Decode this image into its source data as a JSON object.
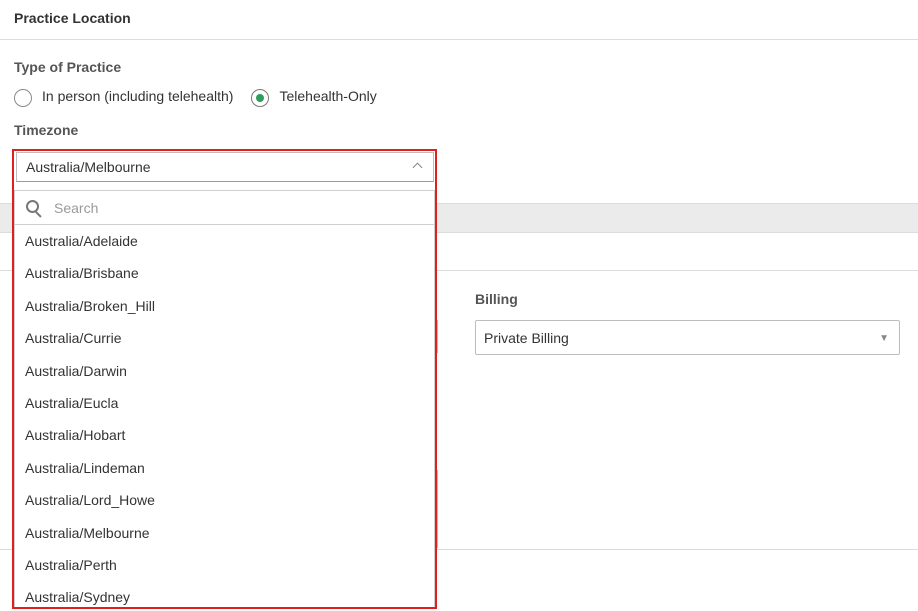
{
  "section": {
    "title": "Practice Location"
  },
  "practice_type": {
    "label": "Type of Practice",
    "options": [
      {
        "label": "In person (including telehealth)",
        "selected": false
      },
      {
        "label": "Telehealth-Only",
        "selected": true
      }
    ]
  },
  "timezone": {
    "label": "Timezone",
    "selected": "Australia/Melbourne",
    "search_placeholder": "Search",
    "options": [
      "Australia/Adelaide",
      "Australia/Brisbane",
      "Australia/Broken_Hill",
      "Australia/Currie",
      "Australia/Darwin",
      "Australia/Eucla",
      "Australia/Hobart",
      "Australia/Lindeman",
      "Australia/Lord_Howe",
      "Australia/Melbourne",
      "Australia/Perth",
      "Australia/Sydney"
    ]
  },
  "billing": {
    "label": "Billing",
    "selected": "Private Billing"
  },
  "colors": {
    "accent_green": "#2e9e5b",
    "highlight_red": "#e0201e"
  }
}
